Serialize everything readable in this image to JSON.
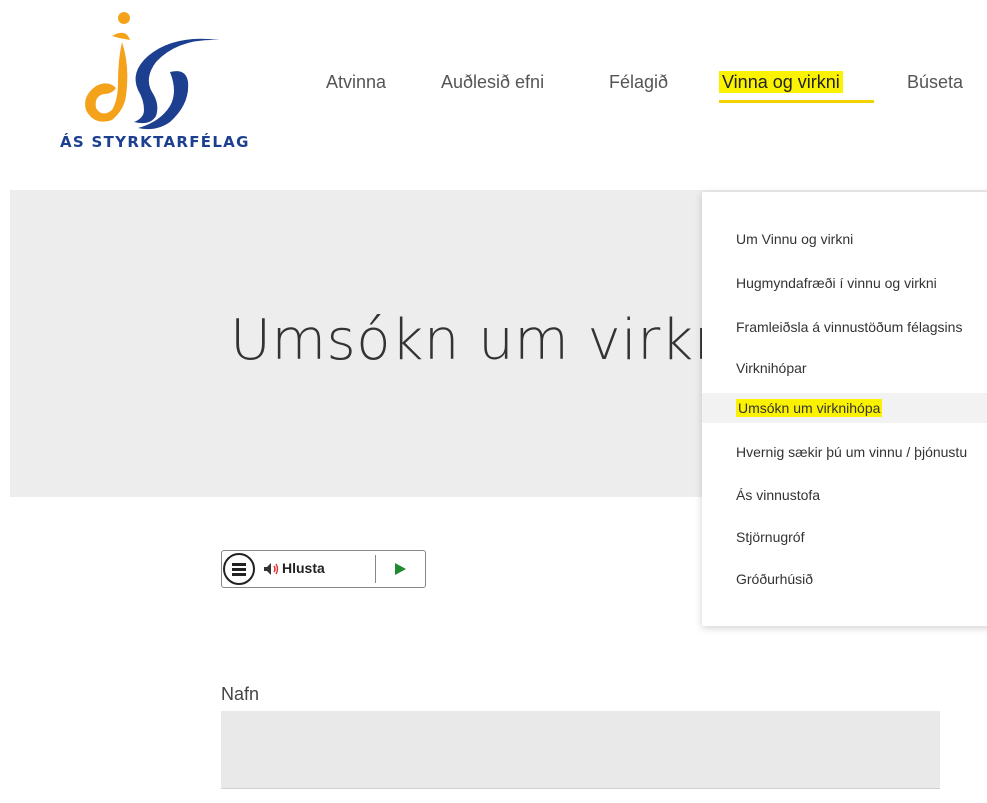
{
  "header": {
    "logo_text": "ÁS STYRKTARFÉLAG",
    "nav": [
      {
        "label": "Atvinna"
      },
      {
        "label": "Auðlesið efni"
      },
      {
        "label": "Félagið"
      },
      {
        "label": "Vinna og virkni"
      },
      {
        "label": "Búseta"
      }
    ],
    "active_index": 3
  },
  "hero": {
    "title": "Umsókn um virknihópa"
  },
  "dropdown": {
    "items": [
      {
        "label": "Um Vinnu og virkni"
      },
      {
        "label": "Hugmyndafræði í vinnu og virkni"
      },
      {
        "label": "Framleiðsla á vinnustöðum félagsins"
      },
      {
        "label": "Virknihópar"
      },
      {
        "label": "Umsókn um virknihópa"
      },
      {
        "label": "Hvernig sækir þú um vinnu / þjónustu"
      },
      {
        "label": "Ás vinnustofa"
      },
      {
        "label": "Stjörnugróf"
      },
      {
        "label": "Gróðurhúsið"
      }
    ],
    "active_index": 4
  },
  "listen": {
    "label": "Hlusta"
  },
  "form": {
    "name_label": "Nafn",
    "name_value": ""
  },
  "colors": {
    "highlight": "#fbf200",
    "underline": "#f2d300",
    "brand_blue": "#1d3f8f",
    "brand_orange": "#f5a21b",
    "play_green": "#1f8a2e"
  }
}
